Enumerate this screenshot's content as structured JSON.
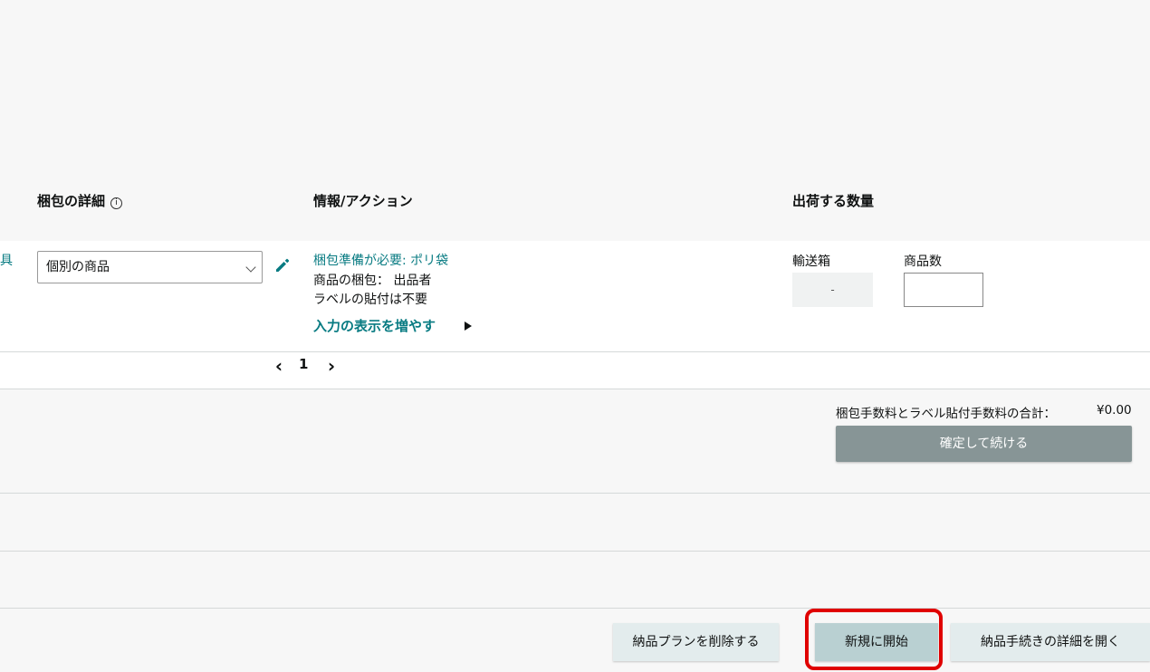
{
  "table": {
    "headers": {
      "packing_details": "梱包の詳細",
      "info_action": "情報/アクション",
      "quantity": "出荷する数量"
    },
    "row": {
      "left_cut_text": "具",
      "packing_select_value": "個別の商品",
      "prep_required": "梱包準備が必要: ポリ袋",
      "packing_by": "商品の梱包： 出品者",
      "label_not_required": "ラベルの貼付は不要",
      "show_more": "入力の表示を増やす",
      "boxes_label": "輸送箱",
      "boxes_value": "-",
      "units_label": "商品数",
      "units_value": ""
    },
    "pagination": {
      "prev": "‹",
      "page": "1",
      "next": "›"
    }
  },
  "summary": {
    "fee_total": "梱包手数料とラベル貼付手数料の合計：",
    "fee_amount": "¥0.00",
    "confirm_button": "確定して続ける"
  },
  "footer": {
    "delete_plan": "納品プランを削除する",
    "start_new": "新規に開始",
    "open_details": "納品手続きの詳細を開く"
  },
  "colors": {
    "teal_link": "#087b82",
    "confirm_button_bg": "#879596",
    "highlight_red": "#e00000"
  }
}
